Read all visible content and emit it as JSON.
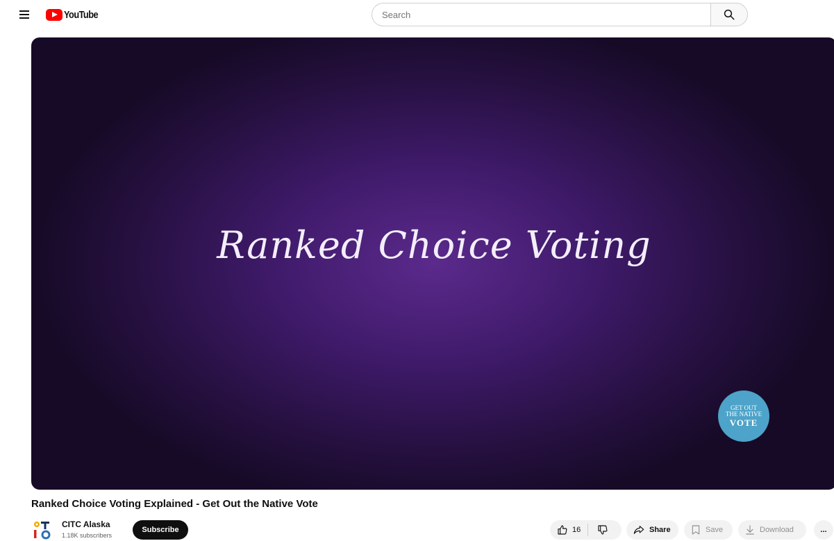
{
  "header": {
    "logo_text": "YouTube",
    "search_placeholder": "Search"
  },
  "video": {
    "frame_text": "Ranked Choice Voting",
    "badge": {
      "line1": "GET OUT",
      "line2": "THE NATIVE",
      "line3": "VOTE"
    },
    "background_color": "#3f1a6a",
    "title": "Ranked Choice Voting Explained - Get Out the Native Vote"
  },
  "channel": {
    "name": "CITC Alaska",
    "subscribers": "1.18K subscribers",
    "subscribe_label": "Subscribe"
  },
  "actions": {
    "like_count": "16",
    "share_label": "Share",
    "save_label": "Save",
    "download_label": "Download",
    "more_label": "..."
  },
  "colors": {
    "brand": "#ff0000",
    "subscribe_bg": "#0f0f0f",
    "badge": "#4da3c9"
  },
  "icons": [
    "menu-icon",
    "youtube-logo-icon",
    "search-icon",
    "thumbs-up-icon",
    "thumbs-down-icon",
    "share-icon",
    "save-icon",
    "download-icon",
    "more-icon"
  ]
}
